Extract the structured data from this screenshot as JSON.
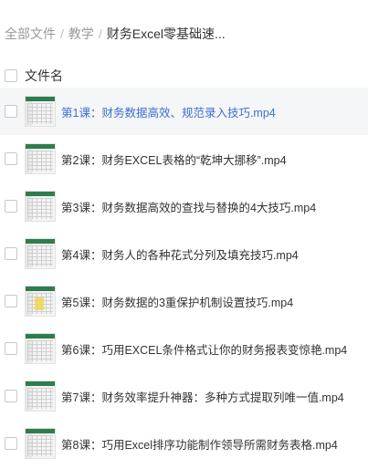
{
  "breadcrumb": {
    "items": [
      "全部文件",
      "教学"
    ],
    "current": "财务Excel零基础速...",
    "separator": "/"
  },
  "header": {
    "column_label": "文件名"
  },
  "files": [
    {
      "name": "第1课：财务数据高效、规范录入技巧.mp4",
      "active": true
    },
    {
      "name": "第2课：财务EXCEL表格的“乾坤大挪移”.mp4",
      "active": false
    },
    {
      "name": "第3课：财务数据高效的查找与替换的4大技巧.mp4",
      "active": false
    },
    {
      "name": "第4课：财务人的各种花式分列及填充技巧.mp4",
      "active": false
    },
    {
      "name": "第5课：财务数据的3重保护机制设置技巧.mp4",
      "active": false
    },
    {
      "name": "第6课：巧用EXCEL条件格式让你的财务报表变惊艳.mp4",
      "active": false
    },
    {
      "name": "第7课：财务效率提升神器：多种方式提取列唯一值.mp4",
      "active": false
    },
    {
      "name": "第8课：巧用Excel排序功能制作领导所需财务表格.mp4",
      "active": false
    }
  ],
  "colors": {
    "active_row_bg": "#f5f6f7",
    "active_text": "#3b6fd6",
    "thumb_header": "#2e7d4f"
  },
  "icons": {
    "thumbnail": "excel-video-thumbnail-icon",
    "checkbox": "checkbox-icon"
  }
}
